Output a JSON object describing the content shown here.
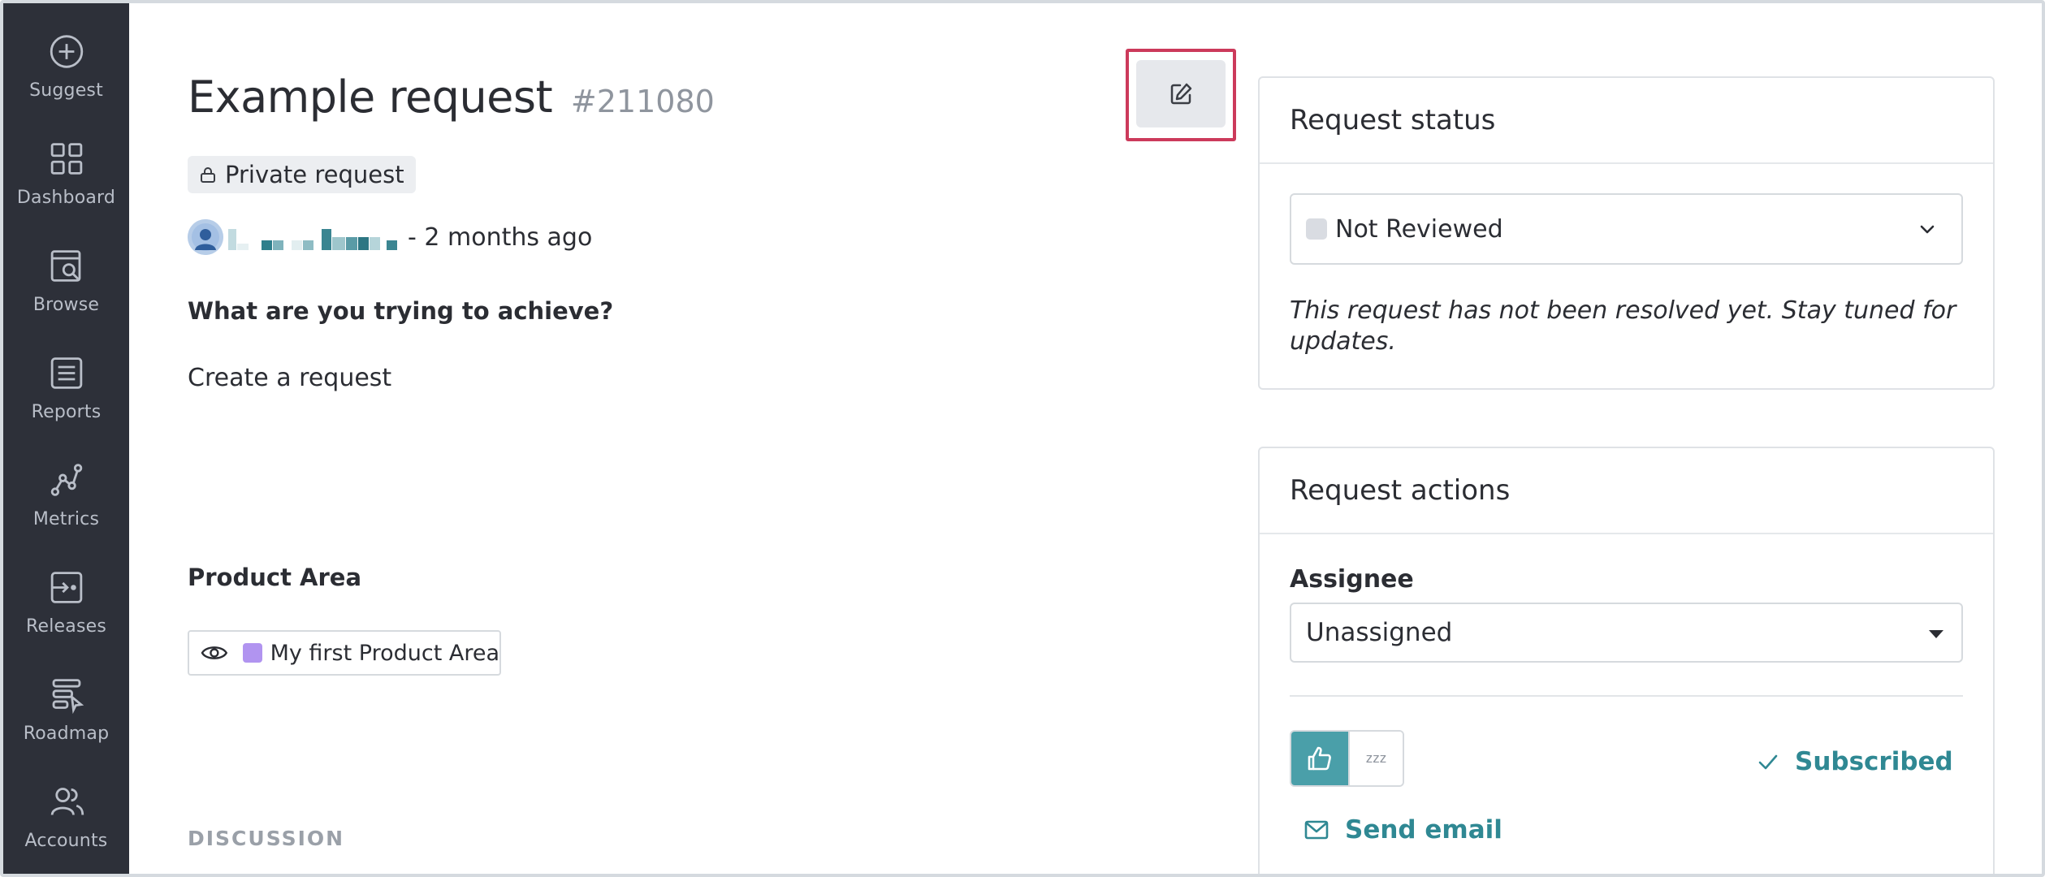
{
  "sidebar": {
    "items": [
      {
        "label": "Suggest",
        "icon": "plus-circle-icon"
      },
      {
        "label": "Dashboard",
        "icon": "grid-icon"
      },
      {
        "label": "Browse",
        "icon": "browse-search-icon"
      },
      {
        "label": "Reports",
        "icon": "list-document-icon"
      },
      {
        "label": "Metrics",
        "icon": "graph-nodes-icon"
      },
      {
        "label": "Releases",
        "icon": "release-arrow-icon"
      },
      {
        "label": "Roadmap",
        "icon": "roadmap-cursor-icon"
      },
      {
        "label": "Accounts",
        "icon": "users-icon"
      }
    ]
  },
  "request": {
    "title": "Example request",
    "number": "#211080",
    "privacy_badge": "Private request",
    "author_time": "- 2 months ago",
    "question_label": "What are you trying to achieve?",
    "question_answer": "Create a request",
    "product_area_label": "Product Area",
    "product_area_value": "My first Product Area",
    "discussion_label": "DISCUSSION"
  },
  "status_card": {
    "header": "Request status",
    "selected_status": "Not Reviewed",
    "note": "This request has not been resolved yet. Stay tuned for updates."
  },
  "actions_card": {
    "header": "Request actions",
    "assignee_label": "Assignee",
    "assignee_value": "Unassigned",
    "snooze_glyph": "zzz",
    "subscribed_label": "Subscribed",
    "send_email_label": "Send email"
  },
  "colors": {
    "sidebar_bg": "#2d3039",
    "accent_teal": "#4a9fa9",
    "link_teal": "#2f8893",
    "highlight_red": "#cc3a5b",
    "product_area_swatch": "#b194f0"
  }
}
